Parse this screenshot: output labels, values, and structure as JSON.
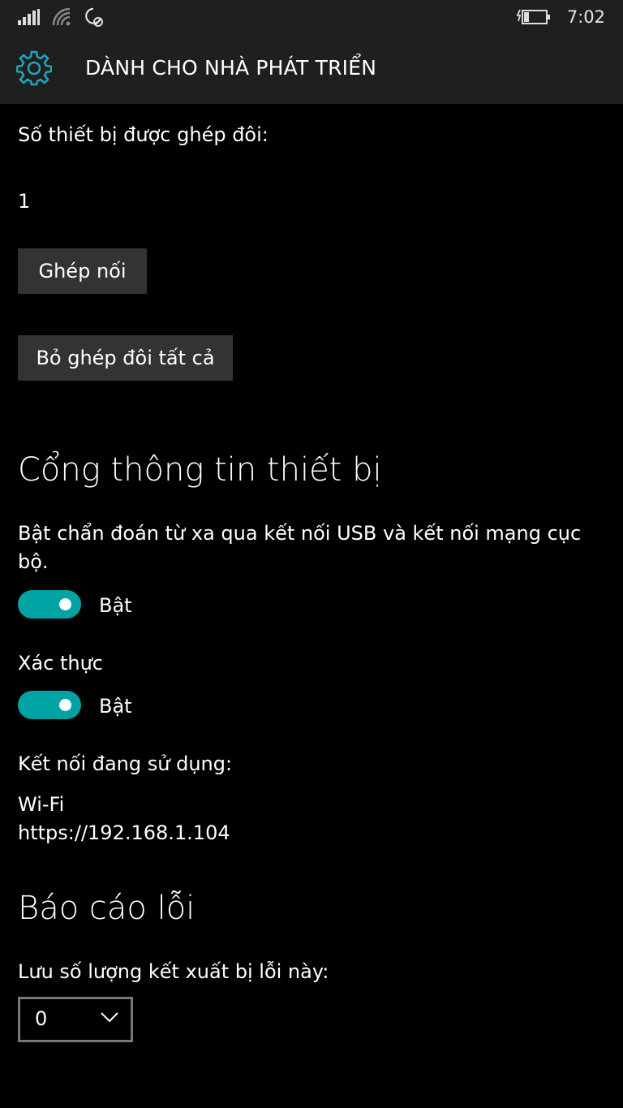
{
  "status_bar": {
    "time": "7:02",
    "icons": [
      "signal-icon",
      "wifi-icon",
      "quiet-hours-icon",
      "battery-charging-icon"
    ]
  },
  "header": {
    "title": "DÀNH CHO NHÀ PHÁT TRIỂN",
    "icon": "gear-icon",
    "accent_color": "#1fa3b8"
  },
  "pairing": {
    "paired_label": "Số thiết bị được ghép đôi:",
    "paired_count": "1",
    "pair_button": "Ghép nối",
    "unpair_all_button": "Bỏ ghép đôi tất cả"
  },
  "device_portal": {
    "heading": "Cổng thông tin thiết bị",
    "remote_diag_label_line1": "Bật chẩn đoán từ xa qua kết nối USB và kết nối mạng cục",
    "remote_diag_label_line2": "bộ.",
    "remote_diag_state": "Bật",
    "auth_label": "Xác thực",
    "auth_state": "Bật",
    "connections_label": "Kết nối đang sử dụng:",
    "connection_type": "Wi-Fi",
    "connection_url": "https://192.168.1.104",
    "toggle_color": "#00a3a3"
  },
  "error_reporting": {
    "heading": "Báo cáo lỗi",
    "dumps_label": "Lưu số lượng kết xuất bị lỗi này:",
    "dumps_selected": "0"
  }
}
